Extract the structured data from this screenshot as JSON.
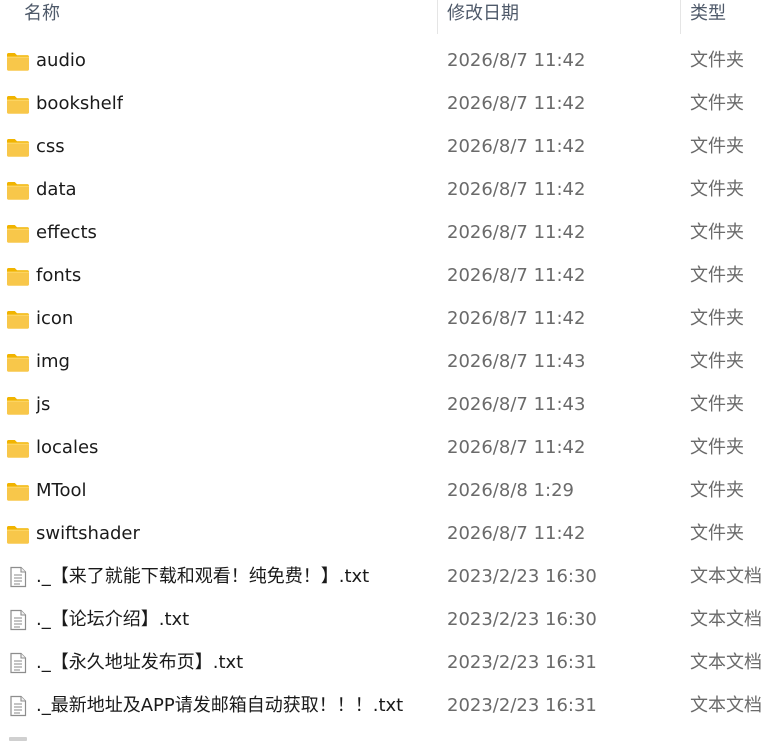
{
  "columns": {
    "name": "名称",
    "date": "修改日期",
    "type": "类型"
  },
  "icons": {
    "folder": "folder-icon",
    "text_file": "text-file-icon"
  },
  "colors": {
    "folder_body": "#f8c74a",
    "folder_tab": "#f1b400",
    "file_border": "#8d8d8d"
  },
  "items": [
    {
      "name": "audio",
      "date": "2026/8/7 11:42",
      "type": "文件夹",
      "kind": "folder"
    },
    {
      "name": "bookshelf",
      "date": "2026/8/7 11:42",
      "type": "文件夹",
      "kind": "folder"
    },
    {
      "name": "css",
      "date": "2026/8/7 11:42",
      "type": "文件夹",
      "kind": "folder"
    },
    {
      "name": "data",
      "date": "2026/8/7 11:42",
      "type": "文件夹",
      "kind": "folder"
    },
    {
      "name": "effects",
      "date": "2026/8/7 11:42",
      "type": "文件夹",
      "kind": "folder"
    },
    {
      "name": "fonts",
      "date": "2026/8/7 11:42",
      "type": "文件夹",
      "kind": "folder"
    },
    {
      "name": "icon",
      "date": "2026/8/7 11:42",
      "type": "文件夹",
      "kind": "folder"
    },
    {
      "name": "img",
      "date": "2026/8/7 11:43",
      "type": "文件夹",
      "kind": "folder"
    },
    {
      "name": "js",
      "date": "2026/8/7 11:43",
      "type": "文件夹",
      "kind": "folder"
    },
    {
      "name": "locales",
      "date": "2026/8/7 11:42",
      "type": "文件夹",
      "kind": "folder"
    },
    {
      "name": "MTool",
      "date": "2026/8/8 1:29",
      "type": "文件夹",
      "kind": "folder"
    },
    {
      "name": "swiftshader",
      "date": "2026/8/7 11:42",
      "type": "文件夹",
      "kind": "folder"
    },
    {
      "name": "._【来了就能下载和观看！纯免费！】.txt",
      "date": "2023/2/23 16:30",
      "type": "文本文档",
      "kind": "text"
    },
    {
      "name": "._【论坛介绍】.txt",
      "date": "2023/2/23 16:30",
      "type": "文本文档",
      "kind": "text"
    },
    {
      "name": "._【永久地址发布页】.txt",
      "date": "2023/2/23 16:31",
      "type": "文本文档",
      "kind": "text"
    },
    {
      "name": "._最新地址及APP请发邮箱自动获取！！！.txt",
      "date": "2023/2/23 16:31",
      "type": "文本文档",
      "kind": "text"
    }
  ]
}
